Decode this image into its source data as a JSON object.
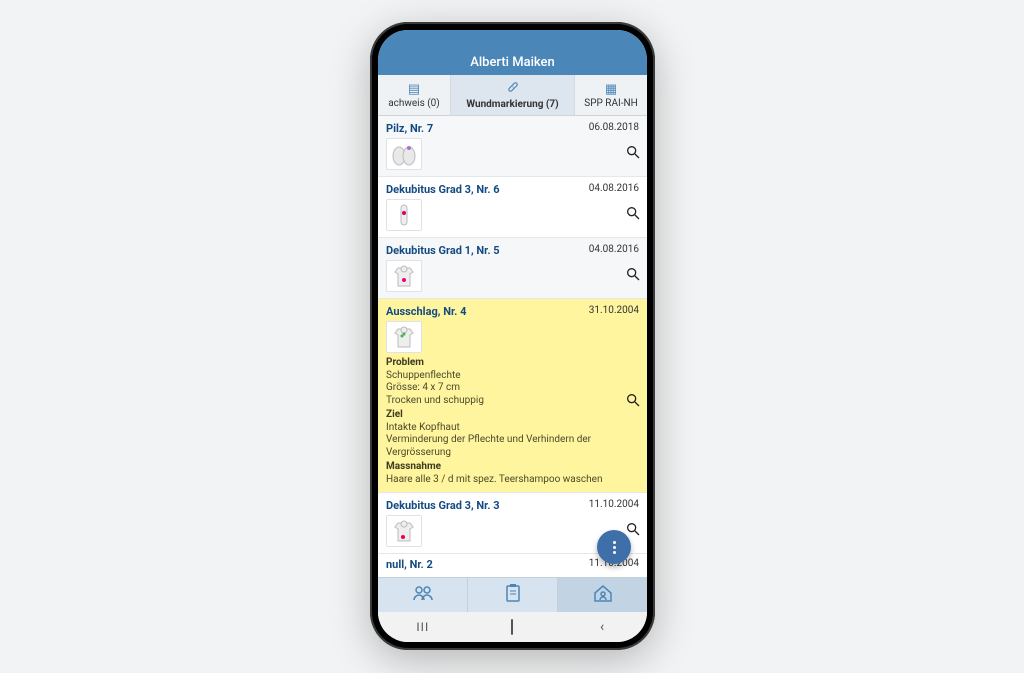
{
  "header": {
    "title": "Alberti Maiken"
  },
  "tabs": {
    "left": {
      "label": "achweis (0)"
    },
    "center": {
      "label": "Wundmarkierung (7)"
    },
    "right": {
      "label": "SPP RAI-NH"
    }
  },
  "list": [
    {
      "title": "Pilz, Nr. 7",
      "date": "06.08.2018",
      "thumb": "feet",
      "alt": true
    },
    {
      "title": "Dekubitus Grad 3, Nr. 6",
      "date": "04.08.2016",
      "thumb": "knee",
      "alt": false
    },
    {
      "title": "Dekubitus Grad 1, Nr. 5",
      "date": "04.08.2016",
      "thumb": "torso-front",
      "alt": true
    },
    {
      "title": "Ausschlag, Nr. 4",
      "date": "31.10.2004",
      "thumb": "torso-back",
      "highlight": true,
      "problem_label": "Problem",
      "problem_text_1": "Schuppenflechte",
      "problem_text_2": "Grösse: 4 x 7 cm",
      "problem_text_3": "Trocken und schuppig",
      "ziel_label": "Ziel",
      "ziel_text_1": "Intakte Kopfhaut",
      "ziel_text_2": "Verminderung der Pflechte und Verhindern der Vergrösserung",
      "mass_label": "Massnahme",
      "mass_text_1": "Haare alle 3 / d mit spez. Teershampoo waschen"
    },
    {
      "title": "Dekubitus Grad 3, Nr. 3",
      "date": "11.10.2004",
      "thumb": "pelvis",
      "alt": false
    },
    {
      "title": "null, Nr. 2",
      "date": "11.10.2004",
      "cut": true
    }
  ]
}
